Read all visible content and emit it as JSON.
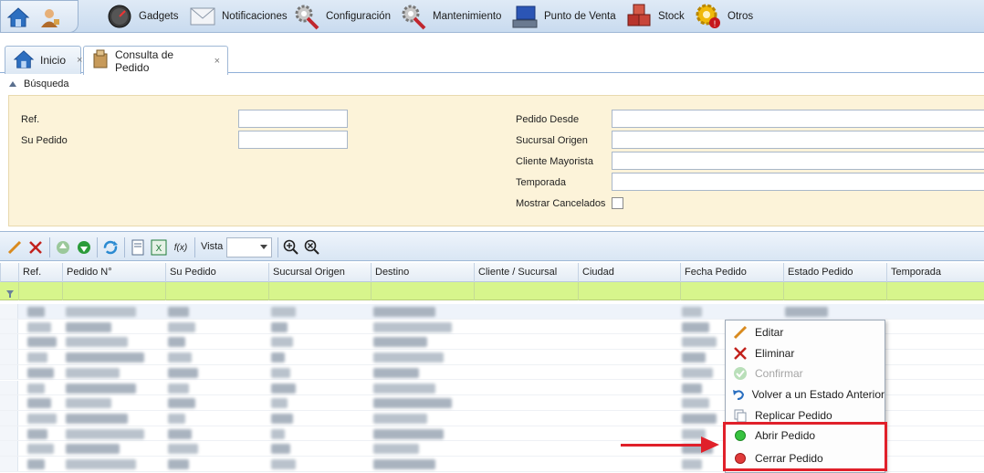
{
  "menubar": {
    "items": [
      {
        "label": "Gadgets",
        "icon": "speedometer-icon"
      },
      {
        "label": "Notificaciones",
        "icon": "envelope-icon"
      },
      {
        "label": "Configuración",
        "icon": "gears-icon"
      },
      {
        "label": "Mantenimiento",
        "icon": "wrench-gears-icon"
      },
      {
        "label": "Punto de Venta",
        "icon": "pos-terminal-icon"
      },
      {
        "label": "Stock",
        "icon": "boxes-icon"
      },
      {
        "label": "Otros",
        "icon": "warning-gear-icon"
      }
    ]
  },
  "tabs": [
    {
      "label": "Inicio",
      "close": "×"
    },
    {
      "label": "Consulta de Pedido",
      "close": "×"
    }
  ],
  "search": {
    "header": "Búsqueda",
    "fields_left": [
      {
        "label": "Ref.",
        "value": ""
      },
      {
        "label": "Su Pedido",
        "value": ""
      }
    ],
    "fields_right": [
      {
        "label": "Pedido Desde",
        "value": ""
      },
      {
        "label": "Sucursal Origen",
        "value": ""
      },
      {
        "label": "Cliente Mayorista",
        "value": ""
      },
      {
        "label": "Temporada",
        "value": ""
      }
    ],
    "checkbox_label": "Mostrar Cancelados",
    "checkbox_checked": false
  },
  "toolbar": {
    "vista_label": "Vista",
    "vista_value": "",
    "fx_label": "f(x)"
  },
  "grid": {
    "columns": [
      "Ref.",
      "Pedido N°",
      "Su Pedido",
      "Sucursal Origen",
      "Destino",
      "Cliente / Sucursal",
      "Ciudad",
      "Fecha Pedido",
      "Estado Pedido",
      "Temporada"
    ]
  },
  "context_menu": {
    "items": [
      {
        "label": "Editar",
        "icon": "pencil-icon",
        "enabled": true
      },
      {
        "label": "Eliminar",
        "icon": "delete-x-icon",
        "enabled": true
      },
      {
        "label": "Confirmar",
        "icon": "check-circle-icon",
        "enabled": false
      },
      {
        "label": "Volver a un Estado Anterior",
        "icon": "undo-icon",
        "enabled": true
      },
      {
        "label": "Replicar Pedido",
        "icon": "copy-icon",
        "enabled": true
      },
      {
        "label": "Abrir Pedido",
        "icon": "green-dot-icon",
        "enabled": true
      },
      {
        "label": "Cerrar Pedido",
        "icon": "red-dot-icon",
        "enabled": true
      }
    ]
  },
  "colors": {
    "accent_blue": "#c9dbef",
    "search_bg": "#fcf3d9",
    "filter_row": "#d7f58c",
    "highlight_red": "#e0202a"
  }
}
